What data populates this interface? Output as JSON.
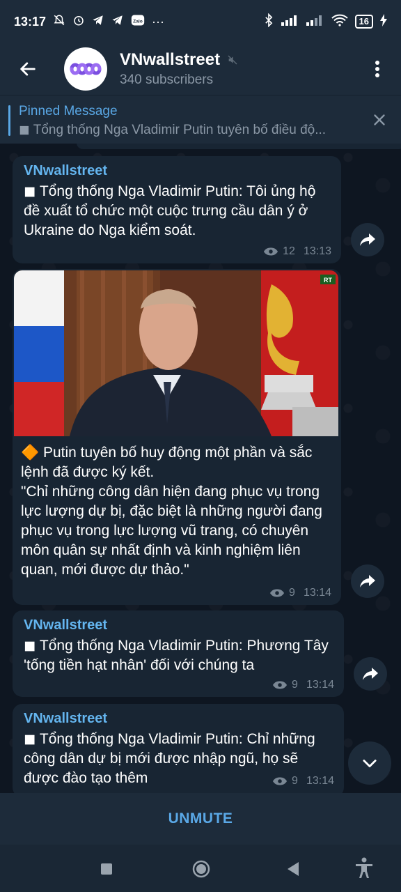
{
  "status_bar": {
    "time": "13:17",
    "battery": "16",
    "more": "···"
  },
  "header": {
    "title": "VNwallstreet",
    "subscribers": "340 subscribers"
  },
  "pinned": {
    "label": "Pinned Message",
    "text": "◼ Tổng thống Nga Vladimir Putin tuyên bố điều độ..."
  },
  "messages": [
    {
      "sender": "VNwallstreet",
      "text": "◼ Tổng thống Nga Vladimir Putin: Tôi ủng hộ đề xuất tổ chức một cuộc trưng cầu dân ý ở Ukraine do Nga kiểm soát.",
      "views": "12",
      "time": "13:13"
    },
    {
      "image_badge": "RT",
      "text_line1": "🔶 Putin tuyên bố huy động một phần và sắc lệnh đã được ký kết.",
      "text_line2": "\"Chỉ những công dân hiện đang phục vụ trong lực lượng dự bị, đặc biệt là những người đang phục vụ trong lực lượng vũ trang, có chuyên môn quân sự nhất định và kinh nghiệm liên quan, mới được dự thảo.\"",
      "views": "9",
      "time": "13:14"
    },
    {
      "sender": "VNwallstreet",
      "text": "◼ Tổng thống Nga Vladimir Putin: Phương Tây 'tống tiền hạt nhân' đối với chúng ta",
      "views": "9",
      "time": "13:14"
    },
    {
      "sender": "VNwallstreet",
      "text": "◼ Tổng thống Nga Vladimir Putin: Chỉ những công dân dự bị mới được nhập ngũ, họ sẽ được đào tạo thêm",
      "views": "9",
      "time": "13:14"
    }
  ],
  "footer": {
    "unmute_label": "UNMUTE"
  },
  "colors": {
    "accent": "#5aa8e6",
    "bubble": "#182533",
    "background": "#0e1621",
    "header": "#1d2b3a"
  },
  "icons": {
    "back": "arrow-left-icon",
    "menu": "more-vert-icon",
    "close": "close-icon",
    "share": "share-icon",
    "views": "eye-icon",
    "scroll_down": "chevron-down-icon",
    "muted": "mute-icon"
  }
}
